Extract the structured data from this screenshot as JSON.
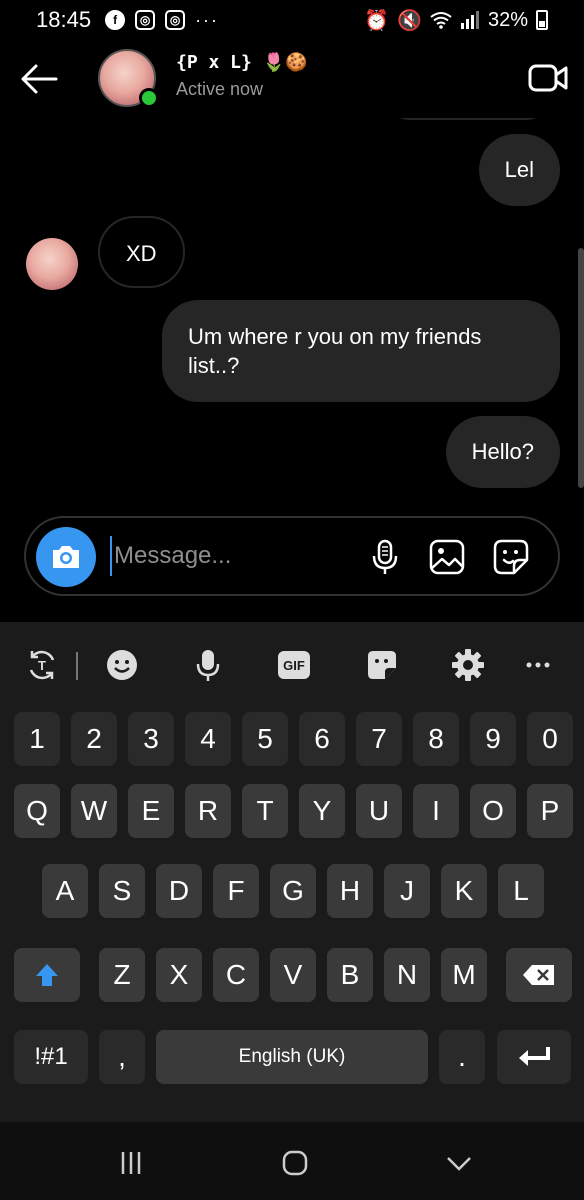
{
  "status_bar": {
    "time": "18:45",
    "app_icons": [
      "facebook-icon",
      "instagram-icon",
      "instagram-icon"
    ],
    "more": "···",
    "battery": "32%"
  },
  "header": {
    "name": "{P x L} 🌷🍪",
    "status": "Active now"
  },
  "messages": [
    {
      "side": "right",
      "text": "Lel"
    },
    {
      "side": "left",
      "text": "XD"
    },
    {
      "side": "right",
      "text": "Um where r you on my friends list..?"
    },
    {
      "side": "right",
      "text": "Hello?"
    }
  ],
  "composer": {
    "placeholder": "Message..."
  },
  "keyboard": {
    "number_row": [
      "1",
      "2",
      "3",
      "4",
      "5",
      "6",
      "7",
      "8",
      "9",
      "0"
    ],
    "row1": [
      "Q",
      "W",
      "E",
      "R",
      "T",
      "Y",
      "U",
      "I",
      "O",
      "P"
    ],
    "row2": [
      "A",
      "S",
      "D",
      "F",
      "G",
      "H",
      "J",
      "K",
      "L"
    ],
    "row3": [
      "Z",
      "X",
      "C",
      "V",
      "B",
      "N",
      "M"
    ],
    "symbols_label": "!#1",
    "comma": ",",
    "space_label": "English (UK)",
    "period": ".",
    "gif_label": "GIF"
  },
  "colors": {
    "accent": "#3797f0",
    "online": "#2bc83a",
    "bubble": "#262626"
  }
}
